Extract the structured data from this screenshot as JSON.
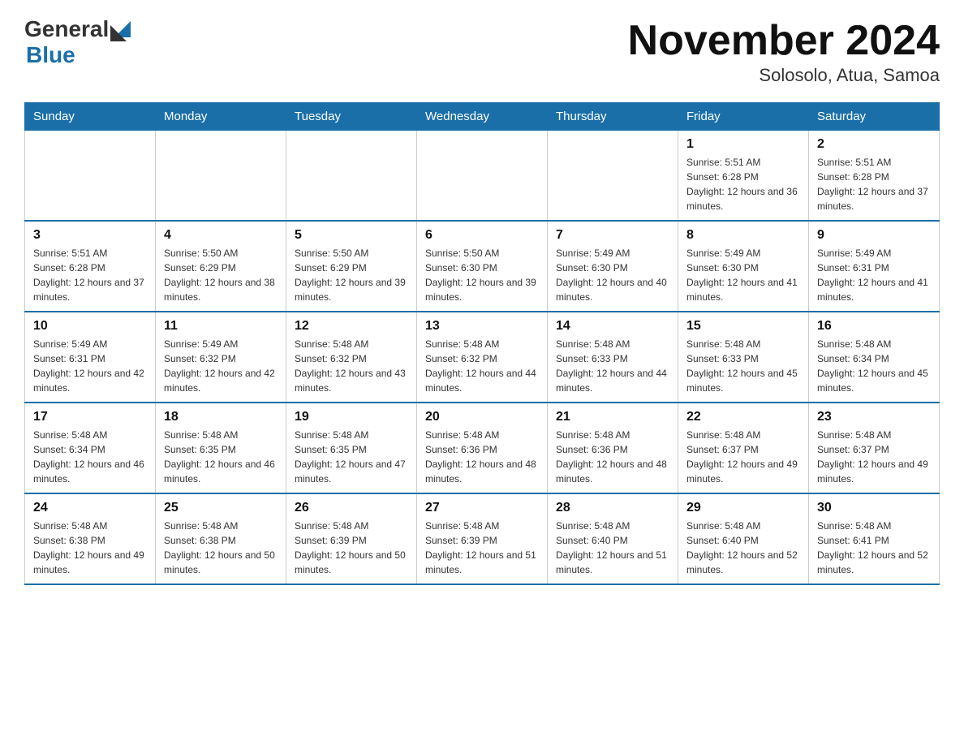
{
  "logo": {
    "general": "General",
    "blue": "Blue"
  },
  "title": "November 2024",
  "subtitle": "Solosolo, Atua, Samoa",
  "days_of_week": [
    "Sunday",
    "Monday",
    "Tuesday",
    "Wednesday",
    "Thursday",
    "Friday",
    "Saturday"
  ],
  "weeks": [
    [
      {
        "day": "",
        "sunrise": "",
        "sunset": "",
        "daylight": ""
      },
      {
        "day": "",
        "sunrise": "",
        "sunset": "",
        "daylight": ""
      },
      {
        "day": "",
        "sunrise": "",
        "sunset": "",
        "daylight": ""
      },
      {
        "day": "",
        "sunrise": "",
        "sunset": "",
        "daylight": ""
      },
      {
        "day": "",
        "sunrise": "",
        "sunset": "",
        "daylight": ""
      },
      {
        "day": "1",
        "sunrise": "Sunrise: 5:51 AM",
        "sunset": "Sunset: 6:28 PM",
        "daylight": "Daylight: 12 hours and 36 minutes."
      },
      {
        "day": "2",
        "sunrise": "Sunrise: 5:51 AM",
        "sunset": "Sunset: 6:28 PM",
        "daylight": "Daylight: 12 hours and 37 minutes."
      }
    ],
    [
      {
        "day": "3",
        "sunrise": "Sunrise: 5:51 AM",
        "sunset": "Sunset: 6:28 PM",
        "daylight": "Daylight: 12 hours and 37 minutes."
      },
      {
        "day": "4",
        "sunrise": "Sunrise: 5:50 AM",
        "sunset": "Sunset: 6:29 PM",
        "daylight": "Daylight: 12 hours and 38 minutes."
      },
      {
        "day": "5",
        "sunrise": "Sunrise: 5:50 AM",
        "sunset": "Sunset: 6:29 PM",
        "daylight": "Daylight: 12 hours and 39 minutes."
      },
      {
        "day": "6",
        "sunrise": "Sunrise: 5:50 AM",
        "sunset": "Sunset: 6:30 PM",
        "daylight": "Daylight: 12 hours and 39 minutes."
      },
      {
        "day": "7",
        "sunrise": "Sunrise: 5:49 AM",
        "sunset": "Sunset: 6:30 PM",
        "daylight": "Daylight: 12 hours and 40 minutes."
      },
      {
        "day": "8",
        "sunrise": "Sunrise: 5:49 AM",
        "sunset": "Sunset: 6:30 PM",
        "daylight": "Daylight: 12 hours and 41 minutes."
      },
      {
        "day": "9",
        "sunrise": "Sunrise: 5:49 AM",
        "sunset": "Sunset: 6:31 PM",
        "daylight": "Daylight: 12 hours and 41 minutes."
      }
    ],
    [
      {
        "day": "10",
        "sunrise": "Sunrise: 5:49 AM",
        "sunset": "Sunset: 6:31 PM",
        "daylight": "Daylight: 12 hours and 42 minutes."
      },
      {
        "day": "11",
        "sunrise": "Sunrise: 5:49 AM",
        "sunset": "Sunset: 6:32 PM",
        "daylight": "Daylight: 12 hours and 42 minutes."
      },
      {
        "day": "12",
        "sunrise": "Sunrise: 5:48 AM",
        "sunset": "Sunset: 6:32 PM",
        "daylight": "Daylight: 12 hours and 43 minutes."
      },
      {
        "day": "13",
        "sunrise": "Sunrise: 5:48 AM",
        "sunset": "Sunset: 6:32 PM",
        "daylight": "Daylight: 12 hours and 44 minutes."
      },
      {
        "day": "14",
        "sunrise": "Sunrise: 5:48 AM",
        "sunset": "Sunset: 6:33 PM",
        "daylight": "Daylight: 12 hours and 44 minutes."
      },
      {
        "day": "15",
        "sunrise": "Sunrise: 5:48 AM",
        "sunset": "Sunset: 6:33 PM",
        "daylight": "Daylight: 12 hours and 45 minutes."
      },
      {
        "day": "16",
        "sunrise": "Sunrise: 5:48 AM",
        "sunset": "Sunset: 6:34 PM",
        "daylight": "Daylight: 12 hours and 45 minutes."
      }
    ],
    [
      {
        "day": "17",
        "sunrise": "Sunrise: 5:48 AM",
        "sunset": "Sunset: 6:34 PM",
        "daylight": "Daylight: 12 hours and 46 minutes."
      },
      {
        "day": "18",
        "sunrise": "Sunrise: 5:48 AM",
        "sunset": "Sunset: 6:35 PM",
        "daylight": "Daylight: 12 hours and 46 minutes."
      },
      {
        "day": "19",
        "sunrise": "Sunrise: 5:48 AM",
        "sunset": "Sunset: 6:35 PM",
        "daylight": "Daylight: 12 hours and 47 minutes."
      },
      {
        "day": "20",
        "sunrise": "Sunrise: 5:48 AM",
        "sunset": "Sunset: 6:36 PM",
        "daylight": "Daylight: 12 hours and 48 minutes."
      },
      {
        "day": "21",
        "sunrise": "Sunrise: 5:48 AM",
        "sunset": "Sunset: 6:36 PM",
        "daylight": "Daylight: 12 hours and 48 minutes."
      },
      {
        "day": "22",
        "sunrise": "Sunrise: 5:48 AM",
        "sunset": "Sunset: 6:37 PM",
        "daylight": "Daylight: 12 hours and 49 minutes."
      },
      {
        "day": "23",
        "sunrise": "Sunrise: 5:48 AM",
        "sunset": "Sunset: 6:37 PM",
        "daylight": "Daylight: 12 hours and 49 minutes."
      }
    ],
    [
      {
        "day": "24",
        "sunrise": "Sunrise: 5:48 AM",
        "sunset": "Sunset: 6:38 PM",
        "daylight": "Daylight: 12 hours and 49 minutes."
      },
      {
        "day": "25",
        "sunrise": "Sunrise: 5:48 AM",
        "sunset": "Sunset: 6:38 PM",
        "daylight": "Daylight: 12 hours and 50 minutes."
      },
      {
        "day": "26",
        "sunrise": "Sunrise: 5:48 AM",
        "sunset": "Sunset: 6:39 PM",
        "daylight": "Daylight: 12 hours and 50 minutes."
      },
      {
        "day": "27",
        "sunrise": "Sunrise: 5:48 AM",
        "sunset": "Sunset: 6:39 PM",
        "daylight": "Daylight: 12 hours and 51 minutes."
      },
      {
        "day": "28",
        "sunrise": "Sunrise: 5:48 AM",
        "sunset": "Sunset: 6:40 PM",
        "daylight": "Daylight: 12 hours and 51 minutes."
      },
      {
        "day": "29",
        "sunrise": "Sunrise: 5:48 AM",
        "sunset": "Sunset: 6:40 PM",
        "daylight": "Daylight: 12 hours and 52 minutes."
      },
      {
        "day": "30",
        "sunrise": "Sunrise: 5:48 AM",
        "sunset": "Sunset: 6:41 PM",
        "daylight": "Daylight: 12 hours and 52 minutes."
      }
    ]
  ]
}
